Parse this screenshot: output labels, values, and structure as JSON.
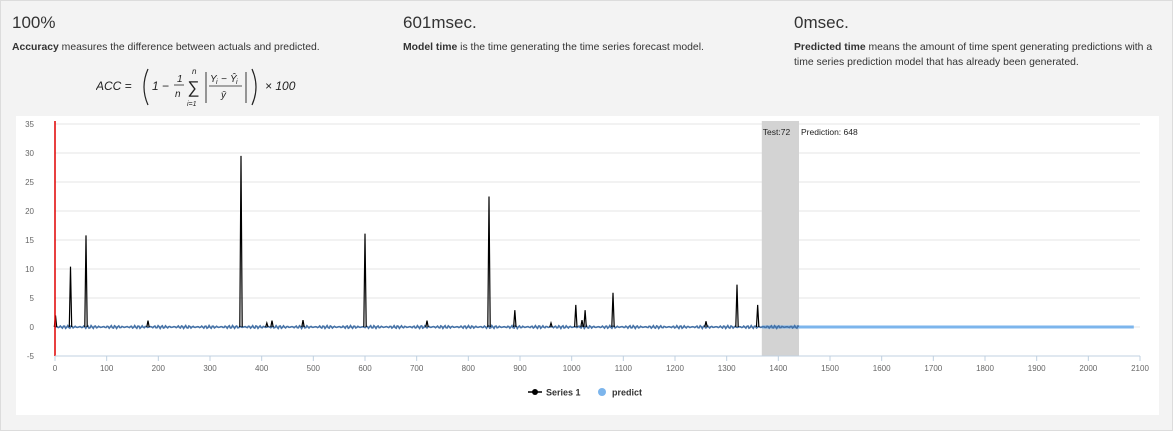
{
  "metrics": {
    "accuracy": {
      "value": "100%",
      "term": "Accuracy",
      "description": " measures the difference between actuals and predicted."
    },
    "model_time": {
      "value": "601msec.",
      "term": "Model time",
      "description": " is the time generating the time series forecast model."
    },
    "predicted_time": {
      "value": "0msec.",
      "term": "Predicted time",
      "description": " means the amount of time spent generating predictions with a time series prediction model that has already been generated."
    }
  },
  "formula": {
    "lhs": "ACC =",
    "rhs": "× 100"
  },
  "chart_data": {
    "type": "line",
    "xlim": [
      0,
      2100
    ],
    "ylim": [
      -5,
      35
    ],
    "x_ticks": [
      0,
      100,
      200,
      300,
      400,
      500,
      600,
      700,
      800,
      900,
      1000,
      1100,
      1200,
      1300,
      1400,
      1500,
      1600,
      1700,
      1800,
      1900,
      2000,
      2100
    ],
    "y_ticks": [
      35,
      30,
      25,
      20,
      15,
      10,
      5,
      0,
      -5
    ],
    "grid": true,
    "red_marker_x": 0,
    "test_band": {
      "x_start": 1368,
      "x_end": 1440,
      "label": "Test:72",
      "prediction_label": "Prediction: 648"
    },
    "series": [
      {
        "name": "Series 1",
        "color": "#000000",
        "spikes": [
          {
            "x": 1,
            "y": 2
          },
          {
            "x": 30,
            "y": 10.4
          },
          {
            "x": 60,
            "y": 15.8
          },
          {
            "x": 180,
            "y": 1.1
          },
          {
            "x": 360,
            "y": 29.5
          },
          {
            "x": 410,
            "y": 0.7
          },
          {
            "x": 420,
            "y": 1.1
          },
          {
            "x": 480,
            "y": 1.2
          },
          {
            "x": 600,
            "y": 16.1
          },
          {
            "x": 720,
            "y": 1.1
          },
          {
            "x": 840,
            "y": 22.5
          },
          {
            "x": 890,
            "y": 2.9
          },
          {
            "x": 960,
            "y": 0.7
          },
          {
            "x": 1008,
            "y": 3.8
          },
          {
            "x": 1020,
            "y": 1.2
          },
          {
            "x": 1026,
            "y": 2.9
          },
          {
            "x": 1080,
            "y": 5.9
          },
          {
            "x": 1260,
            "y": 1.0
          },
          {
            "x": 1320,
            "y": 7.3
          },
          {
            "x": 1360,
            "y": 3.8
          }
        ],
        "baseline": 0,
        "x_end": 1440
      },
      {
        "name": "predict",
        "color": "#7cb5ec",
        "x_start": 1368,
        "x_end": 2088,
        "y": 0
      }
    ],
    "legend": "bottom-center"
  },
  "colors": {
    "series_black": "#000000",
    "series_blue": "#4572a7",
    "predict": "#7cb5ec",
    "red_marker": "#e00000",
    "band": "#d3d3d3"
  }
}
